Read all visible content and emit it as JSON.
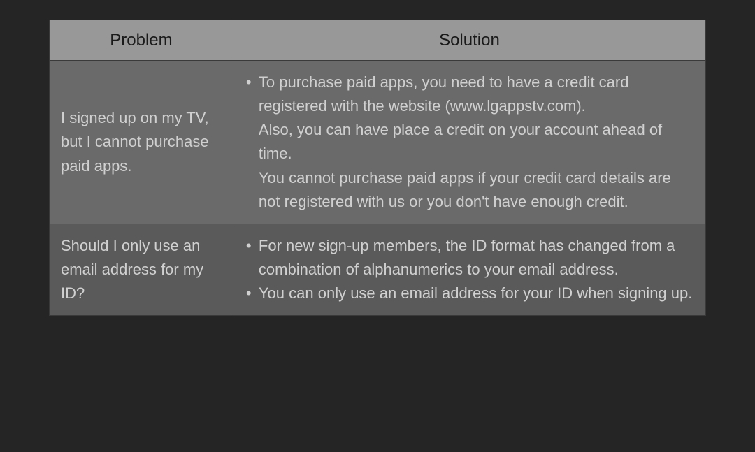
{
  "table": {
    "headers": {
      "problem": "Problem",
      "solution": "Solution"
    },
    "rows": [
      {
        "problem": "I signed up on my TV, but I cannot purchase paid apps.",
        "solutions": [
          "To purchase paid apps, you need to have a credit card registered with the website (www.lgappstv.com).\nAlso, you can have place a credit on your account ahead of time.\nYou cannot purchase paid apps if your credit card details are not registered with us or you don't have enough credit."
        ]
      },
      {
        "problem": "Should I only use an email address for my ID?",
        "solutions": [
          "For new sign-up members, the ID format has changed from a combination of alphanumerics to your email address.",
          "You can only use an email address for your ID when signing up."
        ]
      }
    ]
  }
}
